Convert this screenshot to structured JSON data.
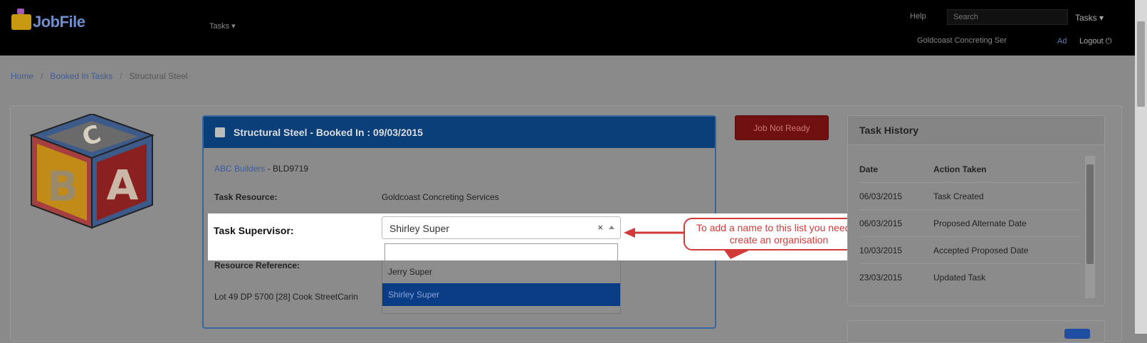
{
  "header": {
    "logo_text": "JobFile",
    "nav_tasks": "Tasks ▾",
    "help": "Help",
    "search_placeholder": "Search",
    "tasks_dropdown": "Tasks ▾",
    "organisation": "Goldcoast Concreting Ser",
    "ad": "Ad",
    "logout": "Logout"
  },
  "breadcrumb": [
    "Home",
    "Booked In Tasks",
    "Structural Steel"
  ],
  "task": {
    "title": "Structural Steel - Booked In : 09/03/2015",
    "client": "ABC Builders",
    "client_code": "- BLD9719",
    "resource_label": "Task Resource:",
    "resource_value": "Goldcoast Concreting Services",
    "supervisor_label": "Task Supervisor:",
    "supervisor_value": "Shirley Super",
    "clear": "×",
    "reference_label": "Resource Reference:",
    "address": "Lot 49 DP 5700 [28] Cook StreetCarin",
    "options": [
      "Jerry Super",
      "Shirley Super"
    ]
  },
  "callout_text": "To add a name to this list you need to create an organisation",
  "job_not_ready": "Job Not Ready",
  "history": {
    "title": "Task History",
    "col_date": "Date",
    "col_action": "Action Taken",
    "rows": [
      {
        "date": "06/03/2015",
        "action": "Task Created"
      },
      {
        "date": "06/03/2015",
        "action": "Proposed Alternate Date"
      },
      {
        "date": "10/03/2015",
        "action": "Accepted Proposed Date"
      },
      {
        "date": "23/03/2015",
        "action": "Updated Task"
      }
    ]
  },
  "colors": {
    "header_bg": "#000000",
    "card_header": "#0a3f7a",
    "callout": "#d23a3a",
    "selected_option": "#0b3c86",
    "link": "#3d5c9a"
  }
}
